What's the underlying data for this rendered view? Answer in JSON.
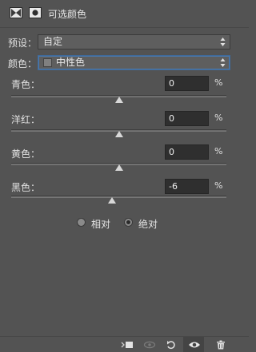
{
  "header": {
    "title": "可选颜色",
    "icons": [
      "adjustment-layer-icon",
      "mask-icon"
    ]
  },
  "preset": {
    "label": "预设：",
    "value": "自定"
  },
  "colors": {
    "label": "颜色：",
    "value": "中性色",
    "swatch_color": "#808080"
  },
  "channels": [
    {
      "label": "青色：",
      "value": "0",
      "unit": "%",
      "level_percent": 0
    },
    {
      "label": "洋红：",
      "value": "0",
      "unit": "%",
      "level_percent": 0
    },
    {
      "label": "黄色：",
      "value": "0",
      "unit": "%",
      "level_percent": 0
    },
    {
      "label": "黑色：",
      "value": "-6",
      "unit": "%",
      "level_percent": -6
    }
  ],
  "method": {
    "options": [
      {
        "label": "相对",
        "selected": false
      },
      {
        "label": "绝对",
        "selected": true
      }
    ]
  },
  "footer": {
    "icons": [
      "clip-to-layer-icon",
      "view-previous-icon",
      "reset-icon",
      "visibility-eye-icon",
      "delete-trash-icon"
    ]
  },
  "theme": {
    "panel_bg": "#535353",
    "input_bg": "#2f2f2f",
    "focus_border": "#4a79ad"
  }
}
